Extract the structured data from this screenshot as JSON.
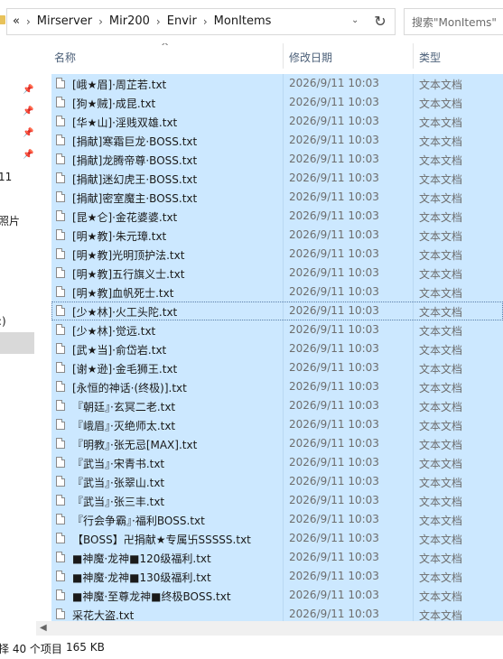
{
  "address": {
    "crumbs": [
      "«",
      "Mirserver",
      "Mir200",
      "Envir",
      "MonItems"
    ],
    "search_placeholder": "搜索\"MonItems\""
  },
  "nav": {
    "labels": [
      "11",
      "照片",
      ":)"
    ]
  },
  "columns": {
    "name": "名称",
    "date": "修改日期",
    "type": "类型"
  },
  "files": [
    {
      "name": "[峨★眉]·周芷若.txt",
      "date": "2026/9/11 10:03",
      "type": "文本文档"
    },
    {
      "name": "[狗★贼]·成昆.txt",
      "date": "2026/9/11 10:03",
      "type": "文本文档"
    },
    {
      "name": "[华★山]·淫贱双雄.txt",
      "date": "2026/9/11 10:03",
      "type": "文本文档"
    },
    {
      "name": "[捐献]寒霜巨龙·BOSS.txt",
      "date": "2026/9/11 10:03",
      "type": "文本文档"
    },
    {
      "name": "[捐献]龙腾帝尊·BOSS.txt",
      "date": "2026/9/11 10:03",
      "type": "文本文档"
    },
    {
      "name": "[捐献]迷幻虎王·BOSS.txt",
      "date": "2026/9/11 10:03",
      "type": "文本文档"
    },
    {
      "name": "[捐献]密室魔主·BOSS.txt",
      "date": "2026/9/11 10:03",
      "type": "文本文档"
    },
    {
      "name": "[昆★仑]·金花婆婆.txt",
      "date": "2026/9/11 10:03",
      "type": "文本文档"
    },
    {
      "name": "[明★教]·朱元璋.txt",
      "date": "2026/9/11 10:03",
      "type": "文本文档"
    },
    {
      "name": "[明★教]光明顶护法.txt",
      "date": "2026/9/11 10:03",
      "type": "文本文档"
    },
    {
      "name": "[明★教]五行旗义士.txt",
      "date": "2026/9/11 10:03",
      "type": "文本文档"
    },
    {
      "name": "[明★教]血帆死士.txt",
      "date": "2026/9/11 10:03",
      "type": "文本文档"
    },
    {
      "name": "[少★林]·火工头陀.txt",
      "date": "2026/9/11 10:03",
      "type": "文本文档"
    },
    {
      "name": "[少★林]·觉远.txt",
      "date": "2026/9/11 10:03",
      "type": "文本文档"
    },
    {
      "name": "[武★当]·俞岱岩.txt",
      "date": "2026/9/11 10:03",
      "type": "文本文档"
    },
    {
      "name": "[谢★逊]·金毛狮王.txt",
      "date": "2026/9/11 10:03",
      "type": "文本文档"
    },
    {
      "name": "[永恒的神话·(终极)].txt",
      "date": "2026/9/11 10:03",
      "type": "文本文档"
    },
    {
      "name": "『朝廷』·玄冥二老.txt",
      "date": "2026/9/11 10:03",
      "type": "文本文档"
    },
    {
      "name": "『峨眉』·灭绝师太.txt",
      "date": "2026/9/11 10:03",
      "type": "文本文档"
    },
    {
      "name": "『明教』·张无忌[MAX].txt",
      "date": "2026/9/11 10:03",
      "type": "文本文档"
    },
    {
      "name": "『武当』·宋青书.txt",
      "date": "2026/9/11 10:03",
      "type": "文本文档"
    },
    {
      "name": "『武当』·张翠山.txt",
      "date": "2026/9/11 10:03",
      "type": "文本文档"
    },
    {
      "name": "『武当』·张三丰.txt",
      "date": "2026/9/11 10:03",
      "type": "文本文档"
    },
    {
      "name": "『行会争霸』·福利BOSS.txt",
      "date": "2026/9/11 10:03",
      "type": "文本文档"
    },
    {
      "name": "【BOSS】卍捐献★专属卐SSSSS.txt",
      "date": "2026/9/11 10:03",
      "type": "文本文档"
    },
    {
      "name": "■神魔·龙神■120级福利.txt",
      "date": "2026/9/11 10:03",
      "type": "文本文档"
    },
    {
      "name": "■神魔·龙神■130级福利.txt",
      "date": "2026/9/11 10:03",
      "type": "文本文档"
    },
    {
      "name": "■神魔·至尊龙神■终极BOSS.txt",
      "date": "2026/9/11 10:03",
      "type": "文本文档"
    },
    {
      "name": "采花大盗.txt",
      "date": "2026/9/11 10:03",
      "type": "文本文档"
    }
  ],
  "status": {
    "count_text": "择 40 个项目",
    "size_text": "165 KB"
  },
  "colors": {
    "selection": "#cce8ff",
    "header_text": "#4c6079"
  },
  "icons": {
    "address": "folder-icon",
    "refresh": "refresh-icon",
    "nav_pin": "pin-icon",
    "file": "text-file-icon"
  }
}
